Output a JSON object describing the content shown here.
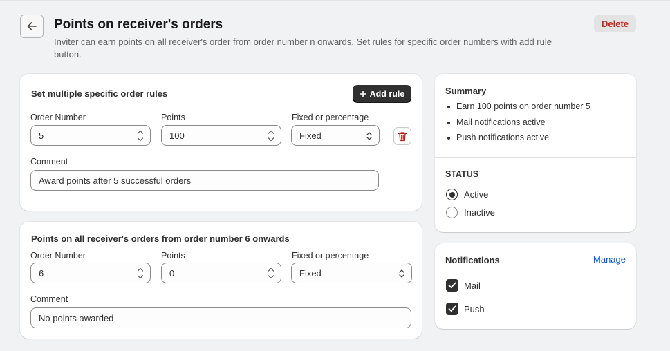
{
  "header": {
    "title": "Points on receiver's orders",
    "subtitle": "Inviter can earn points on all receiver's order from order number n onwards. Set rules for specific order numbers with add rule button.",
    "delete_label": "Delete"
  },
  "specific_rules": {
    "title": "Set multiple specific order rules",
    "add_rule_label": "Add rule",
    "order_number_label": "Order Number",
    "points_label": "Points",
    "type_label": "Fixed or percentage",
    "comment_label": "Comment",
    "rule": {
      "order_number": "5",
      "points": "100",
      "type": "Fixed",
      "comment": "Award points after 5 successful orders"
    }
  },
  "all_orders": {
    "title": "Points on all receiver's orders from order number 6 onwards",
    "order_number_label": "Order Number",
    "points_label": "Points",
    "type_label": "Fixed or percentage",
    "comment_label": "Comment",
    "order_number": "6",
    "points": "0",
    "type": "Fixed",
    "comment": "No points awarded"
  },
  "summary": {
    "title": "Summary",
    "items": [
      "Earn 100 points on order number 5",
      "Mail notifications active",
      "Push notifications active"
    ]
  },
  "status": {
    "title": "STATUS",
    "options": [
      {
        "label": "Active",
        "checked": true
      },
      {
        "label": "Inactive",
        "checked": false
      }
    ]
  },
  "notifications": {
    "title": "Notifications",
    "manage_label": "Manage",
    "items": [
      {
        "label": "Mail",
        "checked": true
      },
      {
        "label": "Push",
        "checked": true
      }
    ]
  },
  "colors": {
    "background": "#f1f2f4",
    "primary_button": "#303030",
    "destructive": "#c22b1e",
    "link": "#005bd3"
  },
  "icons": {
    "back": "arrow-left-icon",
    "add": "plus-icon",
    "delete_rule": "trash-icon",
    "stepper": "chevron-up-down-icon",
    "select": "select-chevron-icon",
    "checkbox": "checkmark-icon"
  }
}
